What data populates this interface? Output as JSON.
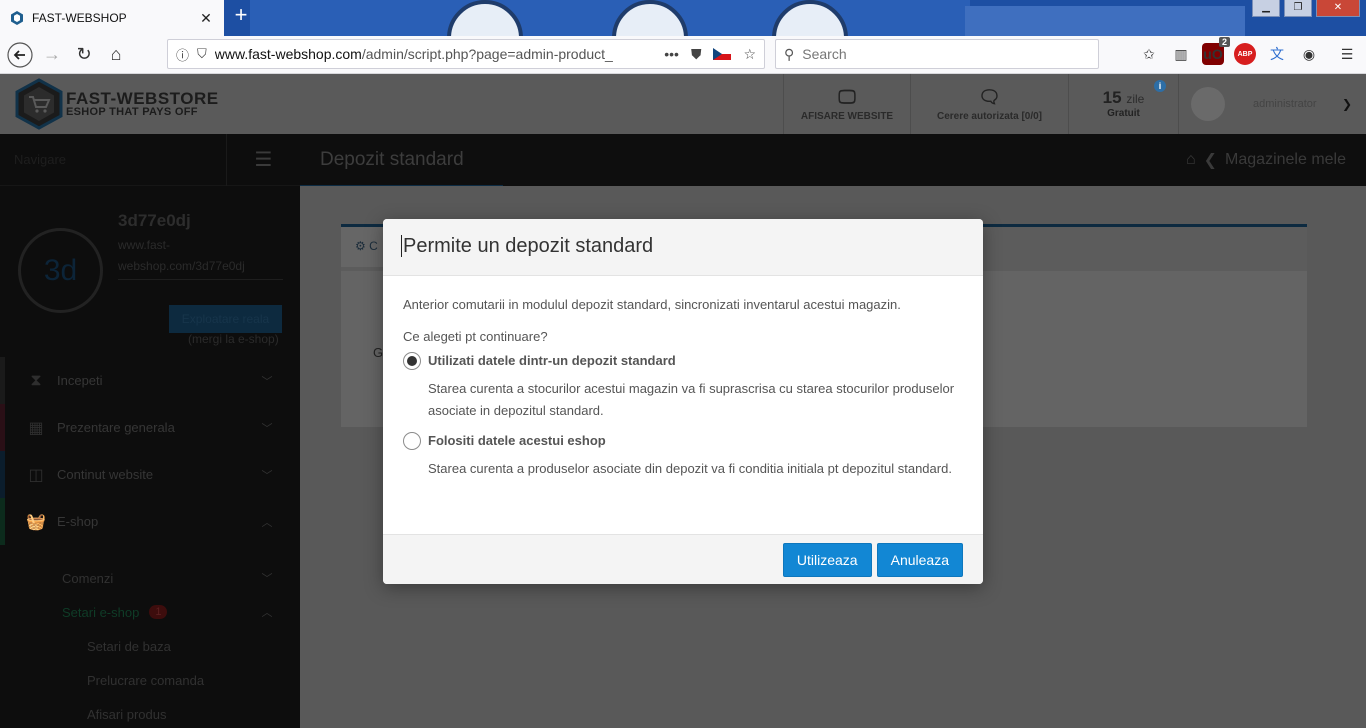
{
  "browser": {
    "tab_title": "FAST-WEBSHOP",
    "url_prefix": "www.fast-webshop.com",
    "url_rest": "/admin/script.php?page=admin-product_",
    "search_placeholder": "Search",
    "ublock_count": "2",
    "ublock_label": "uO",
    "abp_label": "ABP"
  },
  "header": {
    "logo_line1": "FAST-WEBSTORE",
    "logo_line2": "ESHOP THAT PAYS OFF",
    "website_btn": "AFISARE WEBSITE",
    "requests_btn": "Cerere autorizata [0/0]",
    "trial_days": "15",
    "trial_unit": "zile",
    "trial_label": "Gratuit",
    "username": "administrator"
  },
  "sidebar": {
    "nav_label": "Navigare",
    "shop_initials": "3d",
    "shop_name": "3d77e0dj",
    "shop_url": "www.fast-webshop.com/3d77e0dj",
    "goto_shop": "(mergi la e-shop)",
    "exploit_btn": "Exploatare reala",
    "items": [
      {
        "label": "Incepeti",
        "color": "#1a1a1a"
      },
      {
        "label": "Prezentare generala",
        "color": "#2a0f16"
      },
      {
        "label": "Continut website",
        "color": "#0b1d2c"
      },
      {
        "label": "E-shop",
        "color": "#0c2b1c"
      }
    ],
    "sub_comenzi": "Comenzi",
    "sub_setari": "Setari e-shop",
    "sub_setari_count": "1",
    "subsub": [
      "Setari de baza",
      "Prelucrare comanda",
      "Afisari produs"
    ]
  },
  "page": {
    "title": "Depozit standard",
    "breadcrumb": "Magazinele mele",
    "panel_tab": "C",
    "panel_text": "G"
  },
  "modal": {
    "title": "Permite un depozit standard",
    "intro": "Anterior comutarii in modulul depozit standard, sincronizati inventarul acestui magazin.",
    "question": "Ce alegeti pt continuare?",
    "option1_label": "Utilizati datele dintr-un depozit standard",
    "option1_desc": "Starea curenta a stocurilor acestui magazin va fi suprascrisa cu starea stocurilor produselor asociate in depozitul standard.",
    "option2_label": "Folositi datele acestui eshop",
    "option2_desc": "Starea curenta a produselor asociate din depozit va fi conditia initiala pt depozitul standard.",
    "confirm_btn": "Utilizeaza",
    "cancel_btn": "Anuleaza"
  }
}
